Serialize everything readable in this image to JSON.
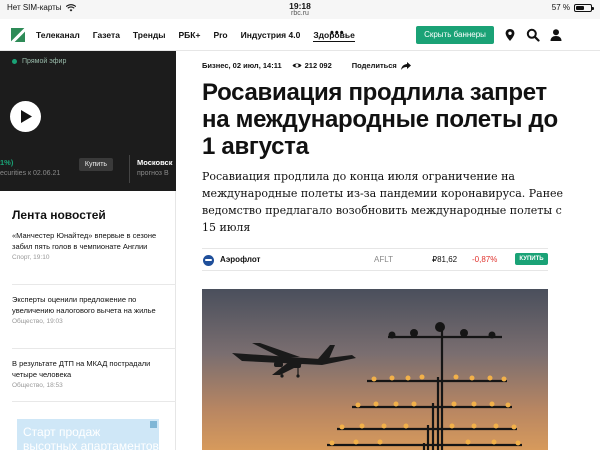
{
  "status_bar": {
    "carrier": "Нет SIM-карты",
    "time": "19:18",
    "url": "rbc.ru",
    "battery": "57 %",
    "battery_level": 0.57
  },
  "nav": {
    "items": [
      {
        "label": "Телеканал"
      },
      {
        "label": "Газета"
      },
      {
        "label": "Тренды"
      },
      {
        "label": "РБК+"
      },
      {
        "label": "Pro"
      },
      {
        "label": "Индустрия 4.0"
      },
      {
        "label": "Здоровье"
      }
    ],
    "more": "•••",
    "subscribe_button": "Скрыть баннеры",
    "icons": [
      "map-pin-icon",
      "search-icon",
      "user-icon"
    ]
  },
  "live": {
    "label": "Прямой эфир",
    "ticker_pct": "1%)",
    "ticker_sub": "ecurities к 02.06.21",
    "buy_button": "Купить",
    "moscow_title": "Московск",
    "moscow_sub": "прогноз В"
  },
  "feed": {
    "title": "Лента новостей",
    "items": [
      {
        "title": "«Манчестер Юнайтед» впервые в сезоне забил пять голов в чемпионате Англии",
        "meta": "Спорт, 19:10"
      },
      {
        "title": "Эксперты оценили предложение по увеличению налогового вычета на жилье",
        "meta": "Общество, 19:03"
      },
      {
        "title": "В результате ДТП на МКАД пострадали четыре человека",
        "meta": "Общество, 18:53"
      }
    ],
    "ad_text": "Старт продаж\nвысотных апартаментов"
  },
  "article": {
    "category_date": "Бизнес, 02 июл, 14:11",
    "views": "212 092",
    "share": "Поделиться",
    "headline": "Росавиация продлила запрет на международные полеты до 1 августа",
    "lead": "Росавиация продлила до конца июля ограничение на международные полеты из-за пандемии коронавируса. Ранее ведомство предлагало возобновить международные полеты с 15 июля",
    "quote": {
      "company": "Аэрофлот",
      "ticker": "AFLT",
      "price": "₽81,62",
      "change": "-0,87%",
      "buy": "КУПИТЬ"
    }
  },
  "colors": {
    "brand_green": "#1aa276",
    "negative_red": "#e0322d",
    "dark_panel": "#1c1c1c"
  }
}
